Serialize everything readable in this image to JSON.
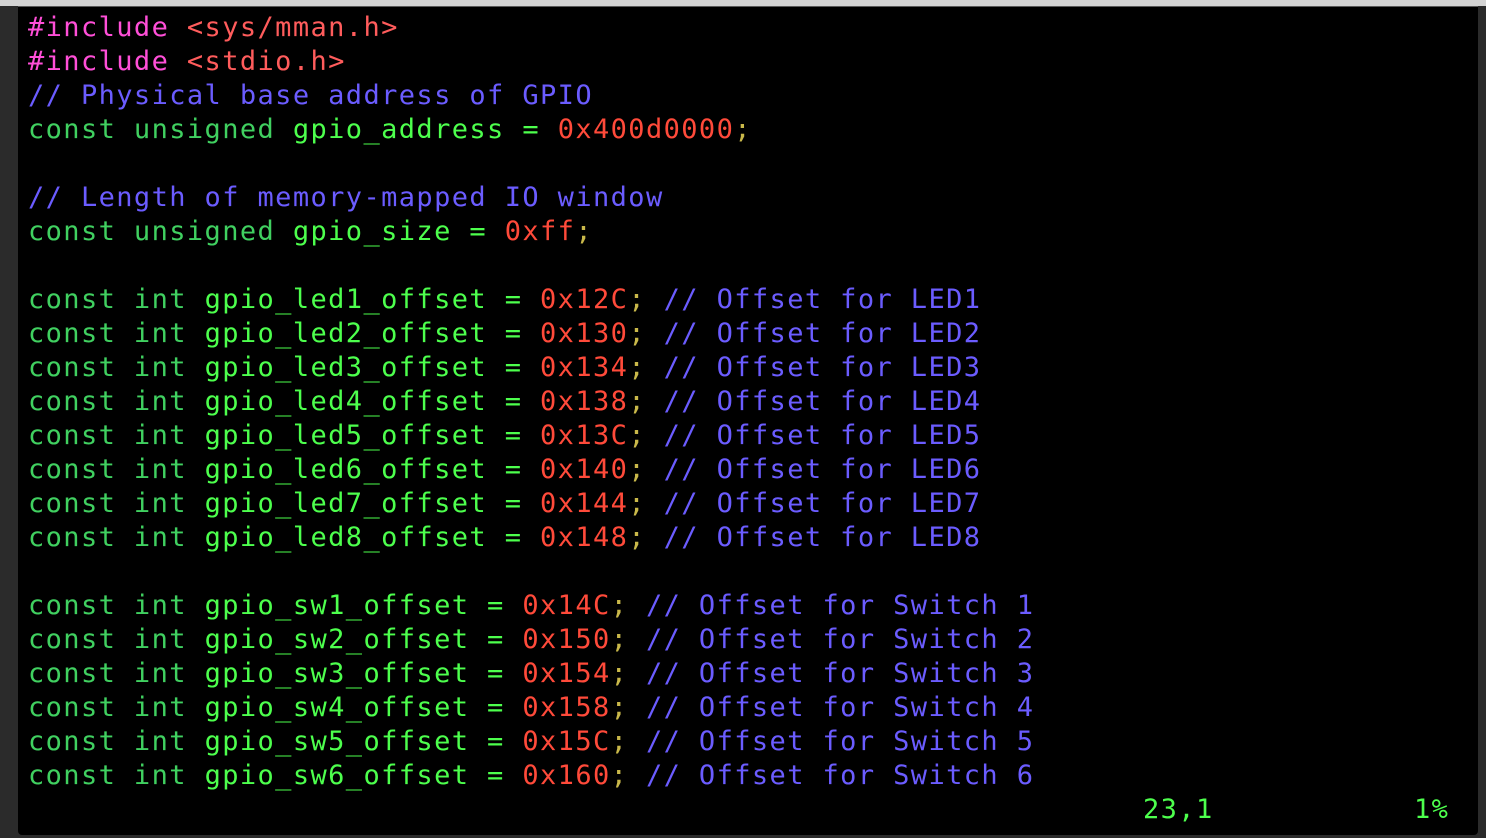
{
  "editor": {
    "lines": [
      {
        "kind": "include",
        "directive": "#include",
        "target": "<sys/mman.h>"
      },
      {
        "kind": "include",
        "directive": "#include",
        "target": "<stdio.h>"
      },
      {
        "kind": "comment",
        "text": "// Physical base address of GPIO"
      },
      {
        "kind": "decl",
        "type": "const unsigned",
        "name": "gpio_address",
        "value": "0x400d0000",
        "comment": ""
      },
      {
        "kind": "blank"
      },
      {
        "kind": "comment",
        "text": "// Length of memory-mapped IO window"
      },
      {
        "kind": "decl",
        "type": "const unsigned",
        "name": "gpio_size",
        "value": "0xff",
        "comment": ""
      },
      {
        "kind": "blank"
      },
      {
        "kind": "decl",
        "type": "const int",
        "name": "gpio_led1_offset",
        "value": "0x12C",
        "comment": "// Offset for LED1"
      },
      {
        "kind": "decl",
        "type": "const int",
        "name": "gpio_led2_offset",
        "value": "0x130",
        "comment": "// Offset for LED2"
      },
      {
        "kind": "decl",
        "type": "const int",
        "name": "gpio_led3_offset",
        "value": "0x134",
        "comment": "// Offset for LED3"
      },
      {
        "kind": "decl",
        "type": "const int",
        "name": "gpio_led4_offset",
        "value": "0x138",
        "comment": "// Offset for LED4"
      },
      {
        "kind": "decl",
        "type": "const int",
        "name": "gpio_led5_offset",
        "value": "0x13C",
        "comment": "// Offset for LED5"
      },
      {
        "kind": "decl",
        "type": "const int",
        "name": "gpio_led6_offset",
        "value": "0x140",
        "comment": "// Offset for LED6"
      },
      {
        "kind": "decl",
        "type": "const int",
        "name": "gpio_led7_offset",
        "value": "0x144",
        "comment": "// Offset for LED7"
      },
      {
        "kind": "decl",
        "type": "const int",
        "name": "gpio_led8_offset",
        "value": "0x148",
        "comment": "// Offset for LED8"
      },
      {
        "kind": "blank"
      },
      {
        "kind": "decl",
        "type": "const int",
        "name": "gpio_sw1_offset",
        "value": "0x14C",
        "comment": "// Offset for Switch 1"
      },
      {
        "kind": "decl",
        "type": "const int",
        "name": "gpio_sw2_offset",
        "value": "0x150",
        "comment": "// Offset for Switch 2"
      },
      {
        "kind": "decl",
        "type": "const int",
        "name": "gpio_sw3_offset",
        "value": "0x154",
        "comment": "// Offset for Switch 3"
      },
      {
        "kind": "decl",
        "type": "const int",
        "name": "gpio_sw4_offset",
        "value": "0x158",
        "comment": "// Offset for Switch 4"
      },
      {
        "kind": "decl",
        "type": "const int",
        "name": "gpio_sw5_offset",
        "value": "0x15C",
        "comment": "// Offset for Switch 5"
      },
      {
        "kind": "decl",
        "type": "const int",
        "name": "gpio_sw6_offset",
        "value": "0x160",
        "comment": "// Offset for Switch 6"
      }
    ]
  },
  "status_line": {
    "cursor_position": "23,1",
    "scroll_percent": "1%"
  },
  "colors": {
    "background": "#000000",
    "preprocessor": "#ff4fd8",
    "include_target": "#ff5c5c",
    "comment": "#6b5cff",
    "keyword": "#40d060",
    "identifier": "#4dff4d",
    "number": "#ff4a3a"
  }
}
